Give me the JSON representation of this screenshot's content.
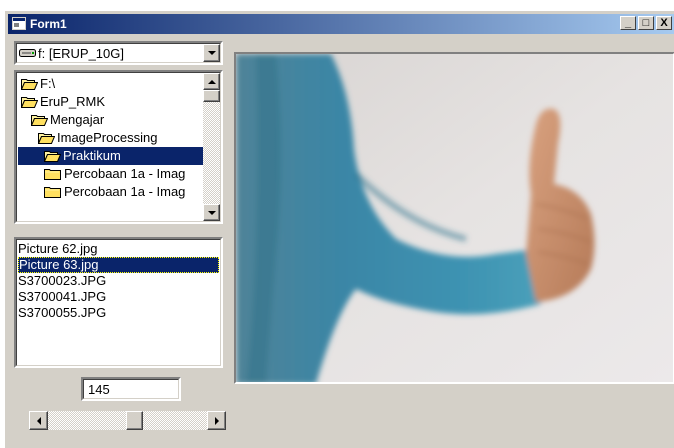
{
  "window": {
    "title": "Form1",
    "minimize_label": "_",
    "maximize_label": "□",
    "close_label": "X",
    "title_gradient_start": "#0a246a",
    "title_gradient_end": "#a6caf0"
  },
  "drive": {
    "selected": "f: [ERUP_10G]"
  },
  "dirs": [
    "F:\\",
    "EruP_RMK",
    "Mengajar",
    "ImageProcessing",
    "Praktikum",
    "Percobaan 1a - Imag",
    "Percobaan 1a - Imag"
  ],
  "dirs_selected": "Praktikum",
  "files": [
    "Picture 62.jpg",
    "Picture 63.jpg",
    "S3700023.JPG",
    "S3700041.JPG",
    "S3700055.JPG"
  ],
  "files_selected": "Picture 63.jpg",
  "value_box": "145",
  "hscroll": {
    "value_fraction": 0.55
  },
  "picture": {
    "description_icon": "thumbs-up-photo"
  },
  "colors": {
    "face": "#d4d0c8",
    "highlight": "#0a246a"
  }
}
